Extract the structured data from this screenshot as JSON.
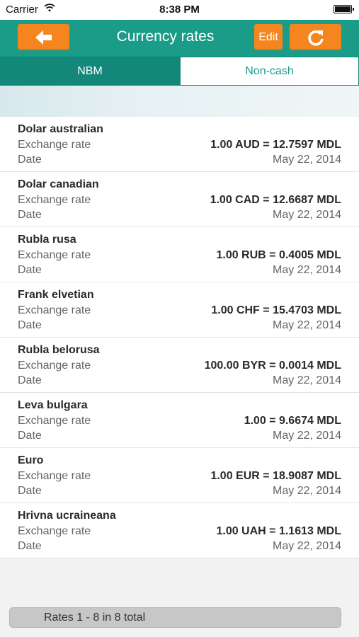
{
  "status_bar": {
    "carrier": "Carrier",
    "time": "8:38 PM"
  },
  "nav": {
    "title": "Currency rates",
    "edit_label": "Edit",
    "back_icon": "arrow-left-icon",
    "refresh_icon": "refresh-icon",
    "accent_color": "#1a9c88",
    "button_color": "#f5861f"
  },
  "tabs": [
    {
      "label": "NBM",
      "selected": false
    },
    {
      "label": "Non-cash",
      "selected": true
    }
  ],
  "rates": [
    {
      "name": "Dolar australian",
      "rate_label": "Exchange rate",
      "rate": "1.00 AUD = 12.7597 MDL",
      "date_label": "Date",
      "date": "May 22, 2014"
    },
    {
      "name": "Dolar canadian",
      "rate_label": "Exchange rate",
      "rate": "1.00 CAD = 12.6687 MDL",
      "date_label": "Date",
      "date": "May 22, 2014"
    },
    {
      "name": "Rubla rusa",
      "rate_label": "Exchange rate",
      "rate": "1.00 RUB = 0.4005 MDL",
      "date_label": "Date",
      "date": "May 22, 2014"
    },
    {
      "name": "Frank elvetian",
      "rate_label": "Exchange rate",
      "rate": "1.00 CHF = 15.4703 MDL",
      "date_label": "Date",
      "date": "May 22, 2014"
    },
    {
      "name": "Rubla belorusa",
      "rate_label": "Exchange rate",
      "rate": "100.00 BYR = 0.0014 MDL",
      "date_label": "Date",
      "date": "May 22, 2014"
    },
    {
      "name": "Leva bulgara",
      "rate_label": "Exchange rate",
      "rate": "1.00 = 9.6674 MDL",
      "date_label": "Date",
      "date": "May 22, 2014"
    },
    {
      "name": "Euro",
      "rate_label": "Exchange rate",
      "rate": "1.00 EUR = 18.9087 MDL",
      "date_label": "Date",
      "date": "May 22, 2014"
    },
    {
      "name": "Hrivna ucraineana",
      "rate_label": "Exchange rate",
      "rate": "1.00 UAH = 1.1613 MDL",
      "date_label": "Date",
      "date": "May 22, 2014"
    }
  ],
  "footer": {
    "summary": "Rates 1 - 8 in 8 total"
  }
}
